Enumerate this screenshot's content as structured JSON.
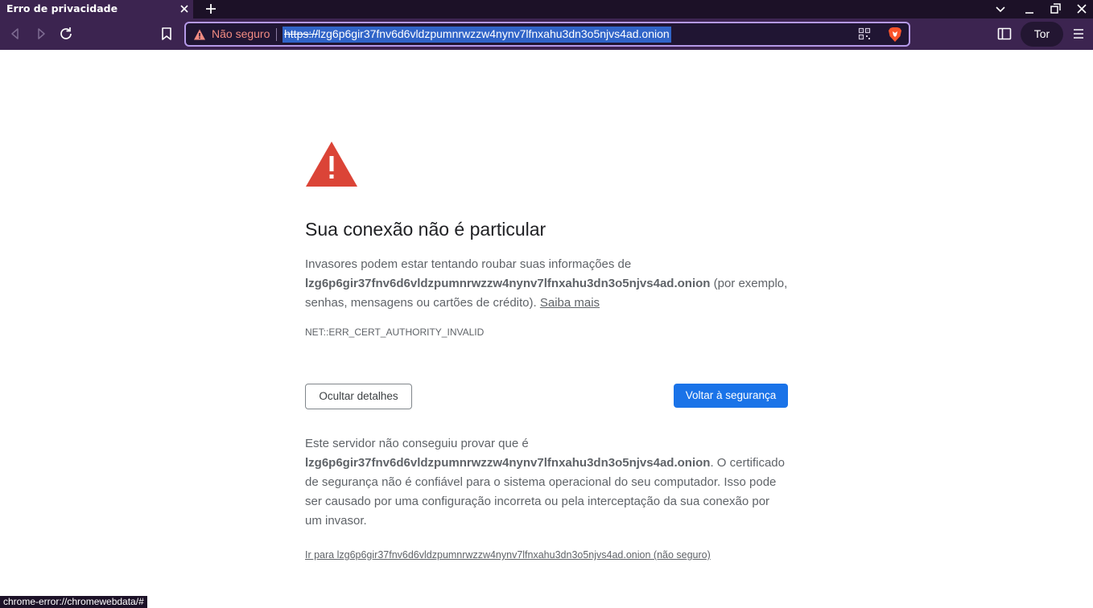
{
  "tab": {
    "title": "Erro de privacidade"
  },
  "urlbar": {
    "security_label": "Não seguro",
    "url_scheme": "https://",
    "url_rest": "lzg6p6gir37fnv6d6vldzpumnrwzzw4nynv7lfnxahu3dn3o5njvs4ad.onion"
  },
  "toolbar": {
    "tor_label": "Tor"
  },
  "interstitial": {
    "heading": "Sua conexão não é particular",
    "p1_before": "Invasores podem estar tentando roubar suas informações de ",
    "host": "lzg6p6gir37fnv6d6vldzpumnrwzzw4nynv7lfnxahu3dn3o5njvs4ad.onion",
    "p1_after": " (por exemplo, senhas, mensagens ou cartões de crédito). ",
    "learn_more": "Saiba mais",
    "error_code": "NET::ERR_CERT_AUTHORITY_INVALID",
    "hide_details_button": "Ocultar detalhes",
    "back_to_safety_button": "Voltar à segurança",
    "p2_before": "Este servidor não conseguiu provar que é ",
    "p2_after": ". O certificado de segurança não é confiável para o sistema operacional do seu computador. Isso pode ser causado por uma configuração incorreta ou pela interceptação da sua conexão por um invasor.",
    "proceed_link": "Ir para lzg6p6gir37fnv6d6vldzpumnrwzzw4nynv7lfnxahu3dn3o5njvs4ad.onion (não seguro)"
  },
  "statusbar": {
    "text": "chrome-error://chromewebdata/#"
  },
  "colors": {
    "accent_blue": "#1a73e8",
    "warning_red": "#db4437",
    "toolbar_purple": "#3c2450"
  }
}
